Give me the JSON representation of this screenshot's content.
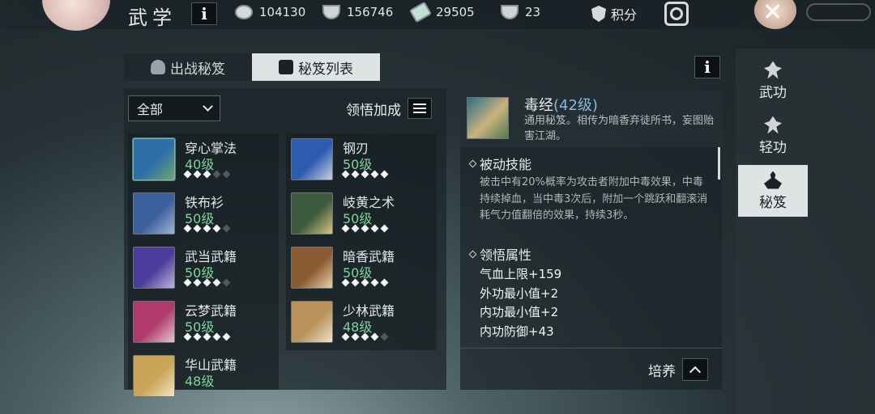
{
  "header": {
    "title": "武学",
    "resources": [
      {
        "icon": "coin-icon",
        "value": "104130"
      },
      {
        "icon": "ingot-icon",
        "value": "156746"
      },
      {
        "icon": "ticket-icon",
        "value": "29505"
      },
      {
        "icon": "bowl-icon",
        "value": "23"
      }
    ],
    "points_label": "积分"
  },
  "tabs": [
    {
      "label": "出战秘笈",
      "active": false
    },
    {
      "label": "秘笈列表",
      "active": true
    }
  ],
  "filter": {
    "selected": "全部"
  },
  "bonus_label": "领悟加成",
  "books_left": [
    {
      "name": "穿心掌法",
      "level": "40级",
      "stars": 3,
      "max": 5,
      "selected": true,
      "colors": [
        "#2f6fa8",
        "#6fa86d"
      ]
    },
    {
      "name": "铁布衫",
      "level": "50级",
      "stars": 4,
      "max": 5,
      "colors": [
        "#3c5f9e",
        "#9cb8d8"
      ]
    },
    {
      "name": "武当武籍",
      "level": "50级",
      "stars": 4,
      "max": 5,
      "colors": [
        "#4c3c9c",
        "#bfb6d8"
      ]
    },
    {
      "name": "云梦武籍",
      "level": "50级",
      "stars": 5,
      "max": 5,
      "colors": [
        "#b03a6c",
        "#e5c7d2"
      ]
    },
    {
      "name": "华山武籍",
      "level": "48级",
      "stars": 0,
      "max": 0,
      "colors": [
        "#c9a55a",
        "#f2e5c0"
      ]
    }
  ],
  "books_right": [
    {
      "name": "钢刃",
      "level": "50级",
      "stars": 5,
      "max": 5,
      "colors": [
        "#2e5cae",
        "#c7d0e0"
      ]
    },
    {
      "name": "岐黄之术",
      "level": "50级",
      "stars": 5,
      "max": 5,
      "colors": [
        "#3d5a3a",
        "#d8c486"
      ]
    },
    {
      "name": "暗香武籍",
      "level": "50级",
      "stars": 5,
      "max": 5,
      "colors": [
        "#8a5a32",
        "#e6d2a8"
      ]
    },
    {
      "name": "少林武籍",
      "level": "48级",
      "stars": 4,
      "max": 5,
      "colors": [
        "#b8925a",
        "#f0e3c8"
      ]
    }
  ],
  "detail": {
    "name": "毒经",
    "level": "(42级)",
    "desc": "通用秘笈。相传为暗香弃徒所书，妄图贻害江湖。",
    "passive_title": "被动技能",
    "passive_text": "被击中有20%概率为攻击者附加中毒效果，中毒持续掉血，当中毒3次后，附加一个跳跃和翻滚消耗气力值翻倍的效果，持续3秒。",
    "attr_title": "领悟属性",
    "attrs": [
      "气血上限+159",
      "外功最小值+2",
      "内功最小值+2",
      "内功防御+43"
    ],
    "cultivate_label": "培养"
  },
  "sidenav": [
    {
      "label": "武功",
      "active": false
    },
    {
      "label": "轻功",
      "active": false
    },
    {
      "label": "秘笈",
      "active": true
    }
  ],
  "info_glyph": "i"
}
